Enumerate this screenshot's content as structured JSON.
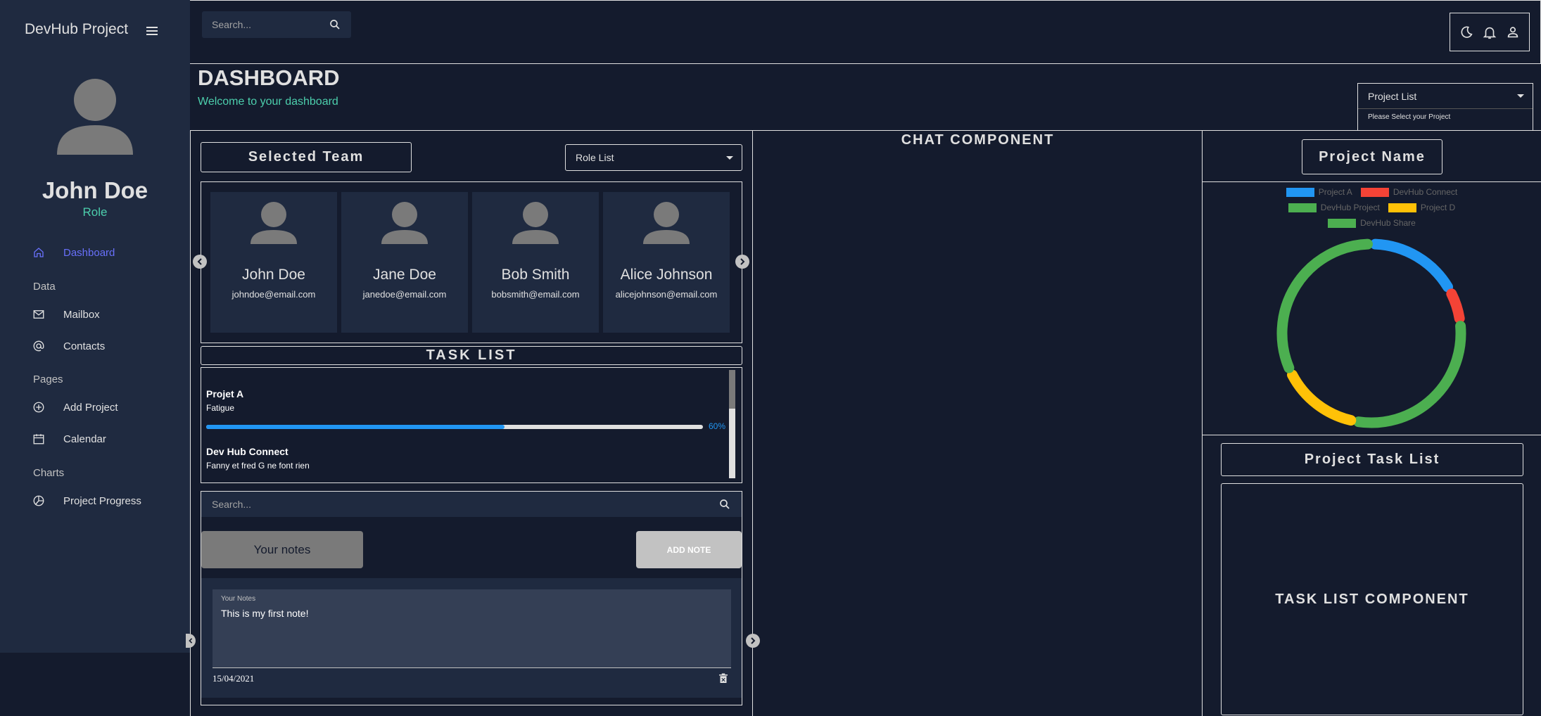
{
  "sidebar": {
    "brand": "DevHub Project",
    "user": {
      "name": "John Doe",
      "role": "Role"
    },
    "items": [
      {
        "label": "Dashboard",
        "icon": "home-icon",
        "active": true
      },
      {
        "label": "Mailbox",
        "icon": "mail-icon"
      },
      {
        "label": "Contacts",
        "icon": "at-icon"
      },
      {
        "label": "Add Project",
        "icon": "add-circle-icon"
      },
      {
        "label": "Calendar",
        "icon": "calendar-icon"
      },
      {
        "label": "Project Progress",
        "icon": "pie-chart-icon"
      }
    ],
    "sections": [
      "Data",
      "Pages",
      "Charts"
    ]
  },
  "topbar": {
    "search_placeholder": "Search...",
    "icons": [
      "moon-icon",
      "bell-icon",
      "person-icon"
    ]
  },
  "header": {
    "title": "DASHBOARD",
    "subtitle": "Welcome to your dashboard",
    "project_select": {
      "value": "Project List",
      "helper": "Please Select your Project"
    }
  },
  "team": {
    "title": "Selected Team",
    "role_select": "Role List",
    "members": [
      {
        "name": "John Doe",
        "email": "johndoe@email.com"
      },
      {
        "name": "Jane Doe",
        "email": "janedoe@email.com"
      },
      {
        "name": "Bob Smith",
        "email": "bobsmith@email.com"
      },
      {
        "name": "Alice Johnson",
        "email": "alicejohnson@email.com"
      }
    ]
  },
  "tasks": {
    "title": "TASK LIST",
    "items": [
      {
        "name": "Projet A",
        "desc": "Fatigue",
        "progress": 0.6,
        "progress_label": "60%"
      },
      {
        "name": "Dev Hub Connect",
        "desc": "Fanny et fred G ne font rien"
      }
    ]
  },
  "notes": {
    "search_placeholder": "Search...",
    "your_notes_label": "Your notes",
    "add_note_label": "ADD NOTE",
    "field_label": "Your Notes",
    "note_text": "This is my first note!",
    "note_date": "15/04/2021"
  },
  "chat": {
    "title": "CHAT COMPONENT"
  },
  "project_panel": {
    "title": "Project Name",
    "task_list_title": "Project Task List",
    "task_list_placeholder": "TASK LIST COMPONENT"
  },
  "chart_data": {
    "type": "pie",
    "donut": true,
    "categories": [
      "Project A",
      "DevHub Connect",
      "DevHub Project",
      "Project D",
      "DevHub Share"
    ],
    "values": [
      17,
      6,
      30,
      15,
      32
    ],
    "colors": [
      "#2196f3",
      "#f44336",
      "#4caf50",
      "#ffc107",
      "#4caf50"
    ],
    "legend": "top",
    "title": ""
  }
}
